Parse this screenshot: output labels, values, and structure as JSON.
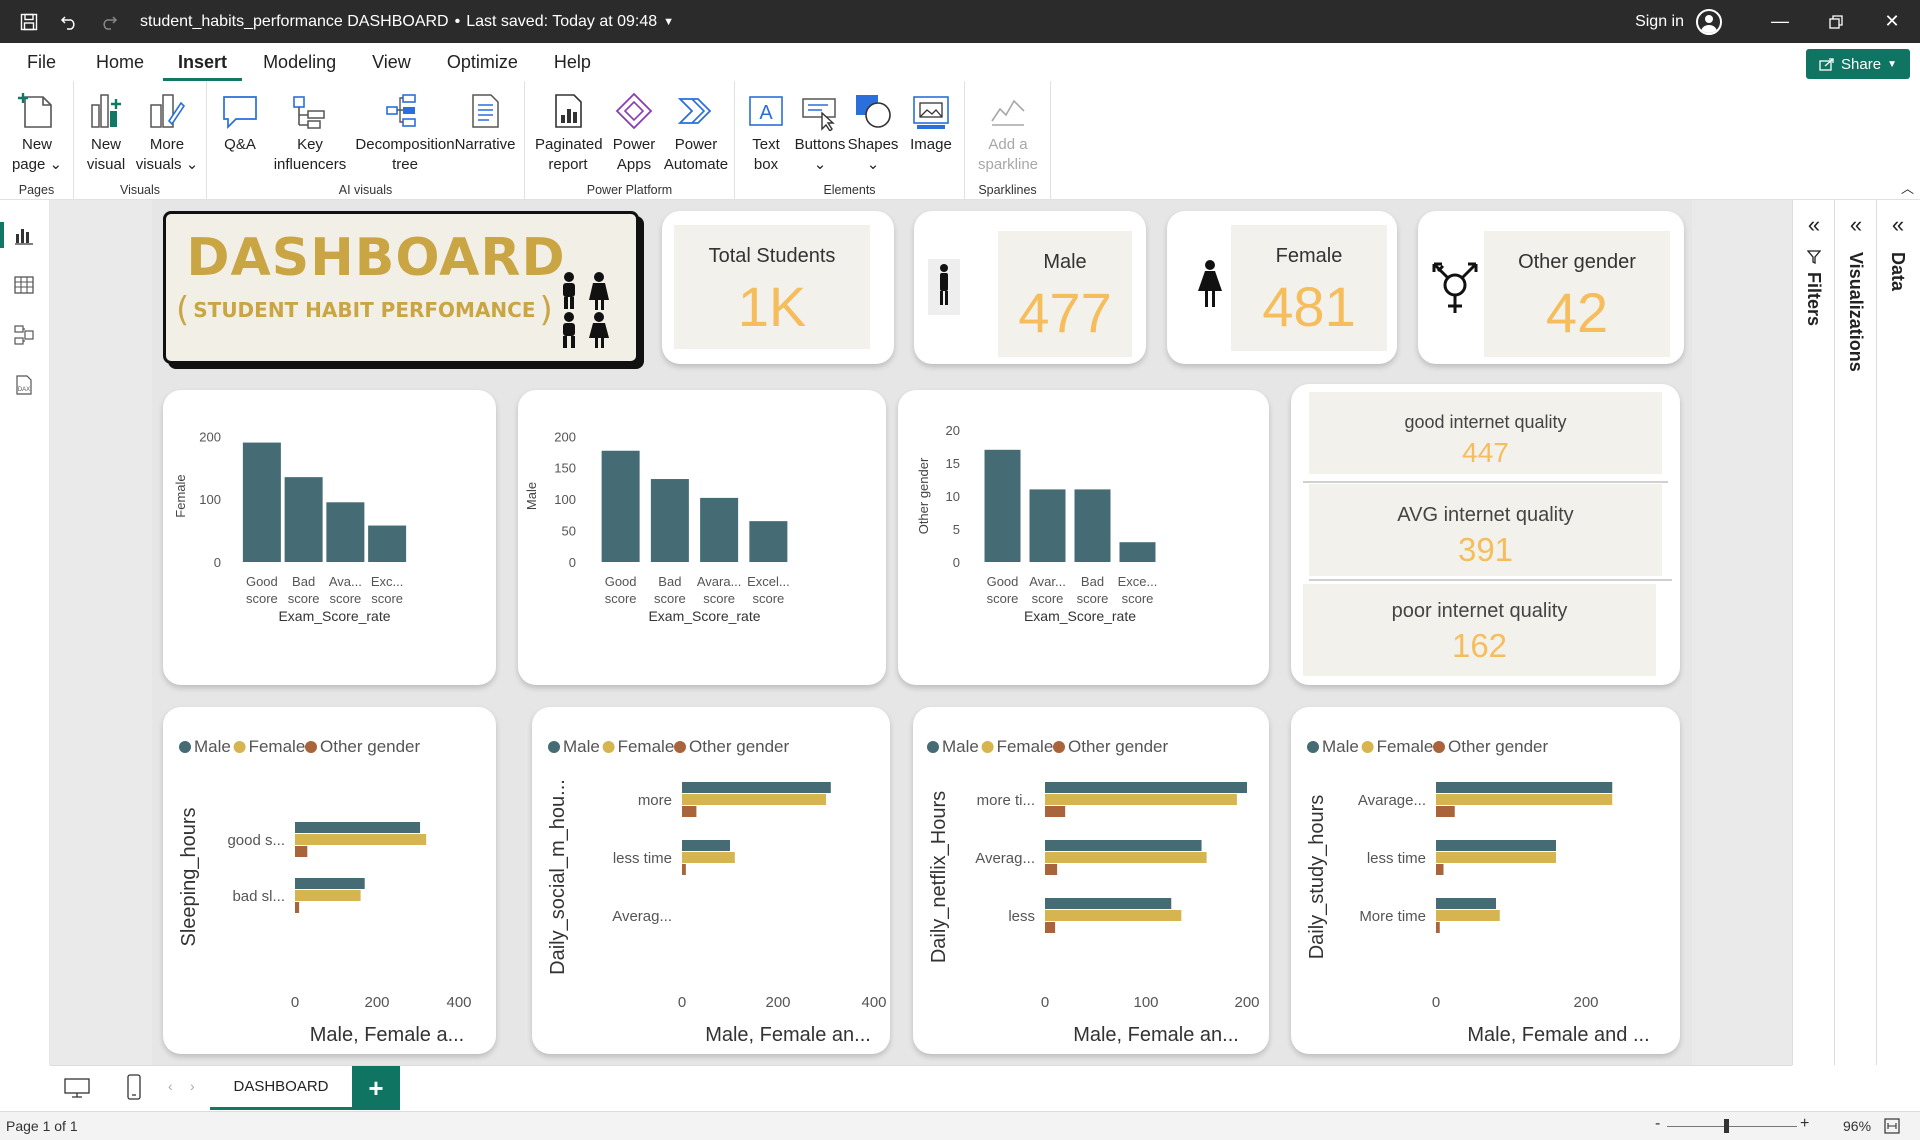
{
  "window": {
    "title": "student_habits_performance DASHBOARD",
    "saved": "Last saved: Today at 09:48",
    "sign_in": "Sign in"
  },
  "menu": [
    "File",
    "Home",
    "Insert",
    "Modeling",
    "View",
    "Optimize",
    "Help"
  ],
  "menu_active": "Insert",
  "share_label": "Share",
  "ribbon": {
    "groups": [
      {
        "label": "Pages",
        "buttons": [
          "New page"
        ]
      },
      {
        "label": "Visuals",
        "buttons": [
          "New visual",
          "More visuals"
        ]
      },
      {
        "label": "AI visuals",
        "buttons": [
          "Q&A",
          "Key influencers",
          "Decomposition tree",
          "Narrative"
        ]
      },
      {
        "label": "Power Platform",
        "buttons": [
          "Paginated report",
          "Power Apps",
          "Power Automate"
        ]
      },
      {
        "label": "Elements",
        "buttons": [
          "Text box",
          "Buttons",
          "Shapes",
          "Image"
        ]
      },
      {
        "label": "Sparklines",
        "buttons": [
          "Add a sparkline"
        ]
      }
    ],
    "btn": {
      "new_page_1": "New",
      "new_page_2": "page",
      "new_visual_1": "New",
      "new_visual_2": "visual",
      "more_visuals_1": "More",
      "more_visuals_2": "visuals",
      "qa": "Q&A",
      "key_inf_1": "Key",
      "key_inf_2": "influencers",
      "decomp_1": "Decomposition",
      "decomp_2": "tree",
      "narrative": "Narrative",
      "paginated_1": "Paginated",
      "paginated_2": "report",
      "power_apps_1": "Power",
      "power_apps_2": "Apps",
      "power_auto_1": "Power",
      "power_auto_2": "Automate",
      "text_box_1": "Text",
      "text_box_2": "box",
      "buttons": "Buttons",
      "shapes": "Shapes",
      "image": "Image",
      "sparkline_1": "Add a",
      "sparkline_2": "sparkline"
    }
  },
  "dashboard": {
    "title": "DASHBOARD",
    "subtitle": "STUDENT HABIT PERFOMANCE",
    "kpis": {
      "total": {
        "label": "Total Students",
        "value": "1K"
      },
      "male": {
        "label": "Male",
        "value": "477"
      },
      "female": {
        "label": "Female",
        "value": "481"
      },
      "other": {
        "label": "Other gender",
        "value": "42"
      }
    },
    "internet": {
      "good": {
        "label": "good internet quality",
        "value": "447"
      },
      "avg": {
        "label": "AVG internet quality",
        "value": "391"
      },
      "poor": {
        "label": "poor internet quality",
        "value": "162"
      }
    },
    "legend": {
      "male": "Male",
      "female": "Female",
      "other": "Other gender"
    },
    "colors": {
      "male": "#456b75",
      "female": "#d6b450",
      "other": "#a9643c",
      "accent": "#f5bd5c",
      "title_gold": "#c9a544",
      "bar": "#456b75"
    }
  },
  "chart_data": [
    {
      "type": "bar",
      "categories": [
        "Good score",
        "Bad score",
        "Ava... score",
        "Exc... score"
      ],
      "values": [
        190,
        135,
        95,
        58
      ],
      "xlabel": "Exam_Score_rate",
      "ylabel": "Female",
      "ylim": [
        0,
        210
      ],
      "yticks": [
        "200",
        "100",
        "0"
      ]
    },
    {
      "type": "bar",
      "categories": [
        "Good score",
        "Bad score",
        "Avara... score",
        "Excel... score"
      ],
      "values": [
        177,
        132,
        102,
        65
      ],
      "xlabel": "Exam_Score_rate",
      "ylabel": "Male",
      "ylim": [
        0,
        210
      ],
      "yticks": [
        "200",
        "150",
        "100",
        "50",
        "0"
      ]
    },
    {
      "type": "bar",
      "categories": [
        "Good score",
        "Avar... score",
        "Bad score",
        "Exce... score"
      ],
      "values": [
        17,
        11,
        11,
        3
      ],
      "xlabel": "Exam_Score_rate",
      "ylabel": "Other gender",
      "ylim": [
        0,
        20
      ],
      "yticks": [
        "20",
        "15",
        "10",
        "5",
        "0"
      ]
    },
    {
      "type": "bar",
      "orientation": "horizontal",
      "categories": [
        "good s...",
        "bad sl..."
      ],
      "series": [
        {
          "name": "Male",
          "values": [
            305,
            170
          ]
        },
        {
          "name": "Female",
          "values": [
            320,
            160
          ]
        },
        {
          "name": "Other gender",
          "values": [
            30,
            10
          ]
        }
      ],
      "xlabel": "Male, Female a...",
      "ylabel": "Sleeping_hours",
      "xlim": [
        0,
        400
      ],
      "xticks": [
        "0",
        "200",
        "400"
      ]
    },
    {
      "type": "bar",
      "orientation": "horizontal",
      "categories": [
        "more",
        "less time",
        "Averag..."
      ],
      "series": [
        {
          "name": "Male",
          "values": [
            310,
            100
          ]
        },
        {
          "name": "Female",
          "values": [
            300,
            110
          ]
        },
        {
          "name": "Other gender",
          "values": [
            30,
            8
          ]
        }
      ],
      "xlabel": "Male, Female an...",
      "ylabel": "Daily_social_m_hou...",
      "xlim": [
        0,
        400
      ],
      "xticks": [
        "0",
        "200",
        "400"
      ]
    },
    {
      "type": "bar",
      "orientation": "horizontal",
      "categories": [
        "more ti...",
        "Averag...",
        "less"
      ],
      "series": [
        {
          "name": "Male",
          "values": [
            200,
            155,
            125
          ]
        },
        {
          "name": "Female",
          "values": [
            190,
            160,
            135
          ]
        },
        {
          "name": "Other gender",
          "values": [
            20,
            12,
            10
          ]
        }
      ],
      "xlabel": "Male, Female an...",
      "ylabel": "Daily_netflix_Hours",
      "xlim": [
        0,
        200
      ],
      "xticks": [
        "0",
        "100",
        "200"
      ]
    },
    {
      "type": "bar",
      "orientation": "horizontal",
      "categories": [
        "Avarage...",
        "less time",
        "More time"
      ],
      "series": [
        {
          "name": "Male",
          "values": [
            235,
            160,
            80
          ]
        },
        {
          "name": "Female",
          "values": [
            235,
            160,
            85
          ]
        },
        {
          "name": "Other gender",
          "values": [
            25,
            10,
            5
          ]
        }
      ],
      "xlabel": "Male, Female and ...",
      "ylabel": "Daily_study_hours",
      "xlim": [
        0,
        300
      ],
      "xticks": [
        "0",
        "200"
      ]
    }
  ],
  "panes": {
    "filters": "Filters",
    "visualizations": "Visualizations",
    "data": "Data"
  },
  "page_tab": "DASHBOARD",
  "status": {
    "page": "Page 1 of 1",
    "zoom": "96%"
  }
}
